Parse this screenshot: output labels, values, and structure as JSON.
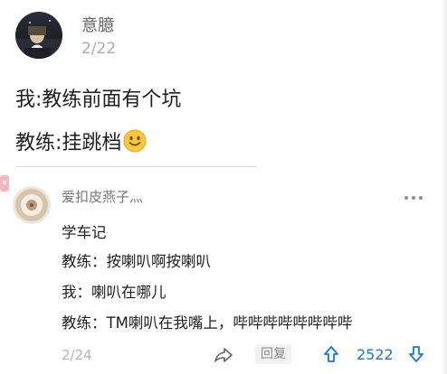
{
  "post": {
    "author": "意臆",
    "date": "2/22",
    "lines": [
      "我:教练前面有个坑",
      "教练:挂跳档"
    ]
  },
  "comment": {
    "author": "爱扣皮燕子灬",
    "lines": [
      "学车记",
      "教练：按喇叭啊按喇叭",
      "我：喇叭在哪儿",
      "教练：TM喇叭在我嘴上，哔哔哔哔哔哔哔哔"
    ],
    "date": "2/24",
    "reply_label": "回复",
    "upvotes": "2522"
  },
  "icons": {
    "more": "more-icon",
    "share": "share-icon",
    "upvote": "upvote-icon",
    "downvote": "downvote-icon",
    "emoji": "smile-emoji-icon"
  },
  "colors": {
    "accent": "#1b74d6",
    "text": "#1f1f1f",
    "muted": "#9a9a9a"
  }
}
